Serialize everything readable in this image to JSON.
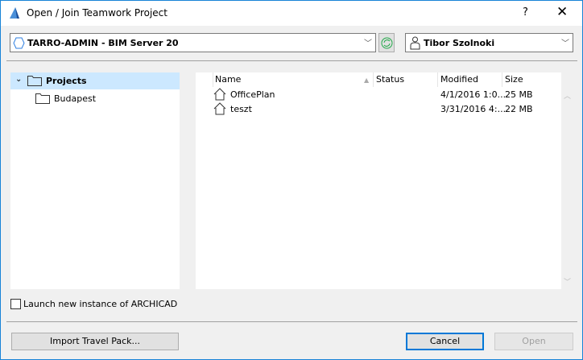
{
  "window": {
    "title": "Open / Join Teamwork Project",
    "help": "?",
    "close": "✕"
  },
  "server": {
    "value": "TARRO-ADMIN - BIM Server 20"
  },
  "user": {
    "value": "Tibor Szolnoki"
  },
  "tree": [
    {
      "label": "Projects",
      "selected": true
    },
    {
      "label": "Budapest"
    }
  ],
  "list": {
    "columns": [
      "Name",
      "Status",
      "Modified",
      "Size"
    ],
    "rows": [
      {
        "name": "OfficePlan",
        "status": "",
        "modified": "4/1/2016 1:0...",
        "size": "25 MB"
      },
      {
        "name": "teszt",
        "status": "",
        "modified": "3/31/2016 4:...",
        "size": "22 MB"
      }
    ]
  },
  "launch_checkbox": {
    "label": "Launch new instance of ARCHICAD",
    "checked": false
  },
  "buttons": {
    "import": "Import Travel Pack...",
    "cancel": "Cancel",
    "open": "Open"
  },
  "colors": {
    "accent": "#1883d7",
    "selection": "#cce8ff"
  }
}
